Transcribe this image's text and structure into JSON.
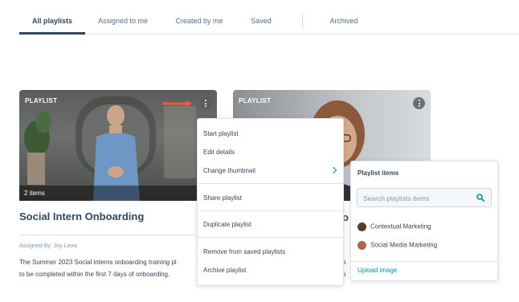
{
  "tabs": [
    {
      "label": "All playlists",
      "active": true
    },
    {
      "label": "Assigned to me"
    },
    {
      "label": "Created by me"
    },
    {
      "label": "Saved"
    },
    {
      "label": "Archived"
    }
  ],
  "cards": [
    {
      "label": "PLAYLIST",
      "items": "2 items",
      "title": "Social Intern Onboarding",
      "assigned": "Assigned By: Joy Leow",
      "description_line1": "The Summer 2023 Social interns onboarding training pl",
      "description_line2": "to be completed within the first 7 days of onboarding."
    },
    {
      "label": "PLAYLIST",
      "title_fragment": "o",
      "desc_fragment_line1": "o",
      "desc_fragment_line2": "o"
    }
  ],
  "menu": {
    "items": [
      "Start playlist",
      "Edit details",
      "Change thumbnail",
      "Share playlist",
      "Duplicate playlist",
      "Remove from saved playlists",
      "Archive playlist"
    ]
  },
  "flyout": {
    "title": "Playlist items",
    "search_placeholder": "Search playlists items",
    "items": [
      "Contextual Marketing",
      "Social Media Marketing"
    ],
    "upload": "Upload image"
  },
  "colors": {
    "accent": "#0091ae",
    "arrow": "#f0573b",
    "text": "#33475b"
  }
}
